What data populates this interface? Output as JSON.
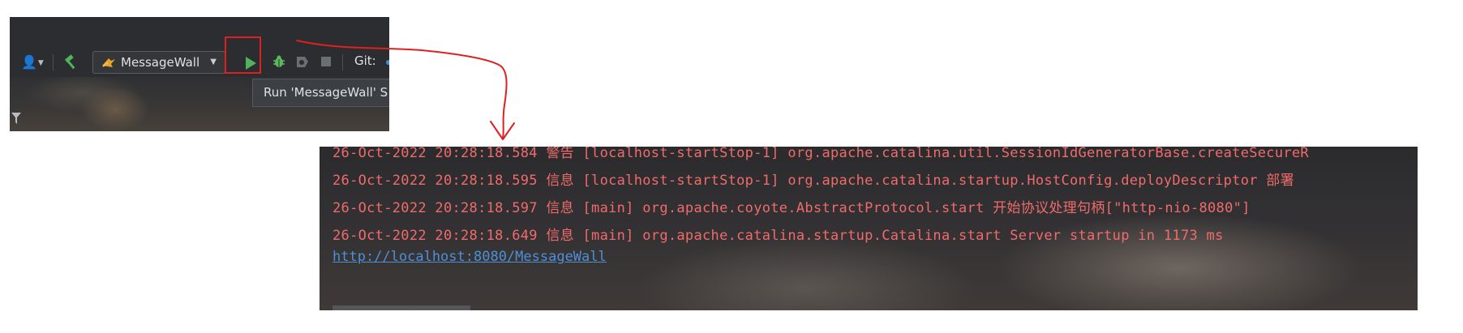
{
  "toolbar": {
    "run_config_label": "MessageWall",
    "git_label": "Git:",
    "tooltip_text": "Run 'MessageWall'  S"
  },
  "console": {
    "lines": [
      "26-Oct-2022 20:28:18.584 警告 [localhost-startStop-1] org.apache.catalina.util.SessionIdGeneratorBase.createSecureR",
      "26-Oct-2022 20:28:18.595 信息 [localhost-startStop-1] org.apache.catalina.startup.HostConfig.deployDescriptor 部署",
      "26-Oct-2022 20:28:18.597 信息 [main] org.apache.coyote.AbstractProtocol.start 开始协议处理句柄[\"http-nio-8080\"]",
      "26-Oct-2022 20:28:18.649 信息 [main] org.apache.catalina.startup.Catalina.start Server startup in 1173 ms"
    ],
    "link": "http://localhost:8080/MessageWall"
  },
  "colors": {
    "toolbar_bg": "#2b2d30",
    "run_green": "#4fb35d",
    "debug_green": "#5cb85c",
    "console_text": "#f06b6b",
    "link_blue": "#4f8fd6",
    "annotation_red": "#e02020"
  },
  "icons": [
    "user-icon",
    "hammer-icon",
    "run-config-icon",
    "run-icon",
    "debug-icon",
    "profile-icon",
    "stop-icon",
    "filter-icon"
  ]
}
